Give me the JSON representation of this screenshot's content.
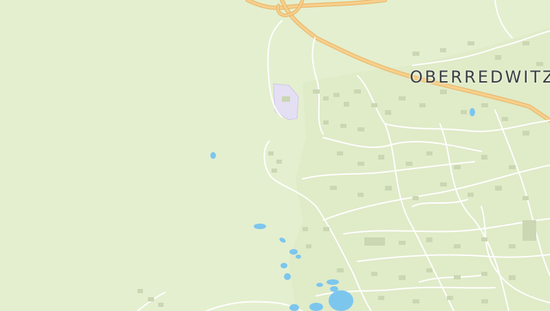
{
  "map": {
    "place_label": "OBERREDWITZ",
    "colors": {
      "background": "#e4efcf",
      "forest": "#d9e9bf",
      "major_road": "#f6cf8c",
      "major_road_casing": "#e9b260",
      "minor_road": "#ffffff",
      "water": "#7cc6ee",
      "special_area": "#e5dff4",
      "buildings": "#cbd6b3",
      "label_text": "#3b3f46"
    }
  }
}
